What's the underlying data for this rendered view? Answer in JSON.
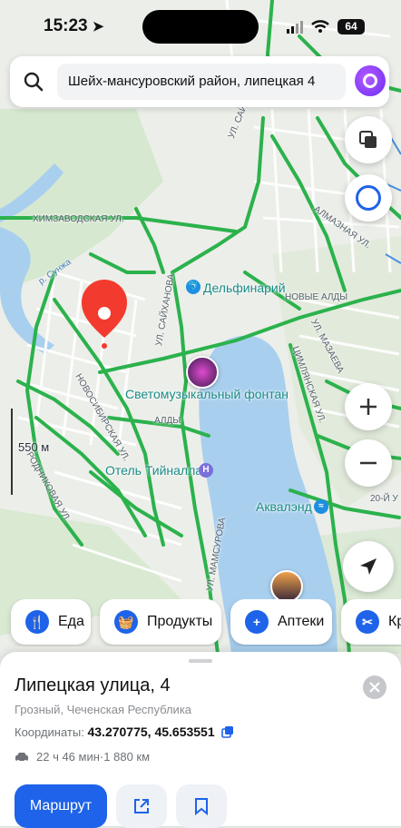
{
  "status_bar": {
    "time": "15:23",
    "battery": "64"
  },
  "search": {
    "query": "Шейх-мансуровский район, липецкая 4"
  },
  "map_labels": {
    "dolphinarium": "Дельфинарий",
    "fountain": "Светомузыкальный фонтан",
    "hotel": "Отель Тийналла",
    "aqualand": "Аквалэнд",
    "aldy": "АЛДЫ",
    "new_aldy": "НОВЫЕ АЛДЫ",
    "street_khimzavodskaya": "ХИМЗАВОДСКАЯ УЛ.",
    "river_sunzha": "р. Сунжа",
    "street_saykhanova_1": "УЛ. САЙХАНОВА",
    "street_saykhanova_2": "УЛ. САЙХАНОВА",
    "street_novosibirskaya": "НОВОСИБИРСКАЯ УЛ.",
    "street_rodnikovaya": "РОДНИКОВАЯ УЛ.",
    "street_mamsurova": "УЛ. МАМСУРОВА",
    "street_mazaeva": "УЛ. МАЗАЕВА",
    "street_tsimlyanskaya": "ЦИМЛЯНСКАЯ УЛ.",
    "street_almaznaya": "АЛМАЗНАЯ УЛ.",
    "street_20": "20-Й У",
    "scale": "550 м"
  },
  "categories": [
    {
      "label": "Еда",
      "icon": "fork-knife-icon"
    },
    {
      "label": "Продукты",
      "icon": "basket-icon"
    },
    {
      "label": "Аптеки",
      "icon": "plus-icon"
    },
    {
      "label": "Кр",
      "icon": "scissors-icon"
    }
  ],
  "place": {
    "title": "Липецкая улица, 4",
    "subtitle": "Грозный, Чеченская Республика",
    "coords_label": "Координаты:",
    "coords_value": "43.270775, 45.653551",
    "route_time": "22 ч 46 мин",
    "route_sep": " · ",
    "route_distance": "1 880 км"
  },
  "buttons": {
    "route": "Маршрут"
  },
  "colors": {
    "accent": "#1e63e9",
    "traffic": "#2bb24c",
    "water": "#a9cfef",
    "pin": "#f33a2e"
  }
}
